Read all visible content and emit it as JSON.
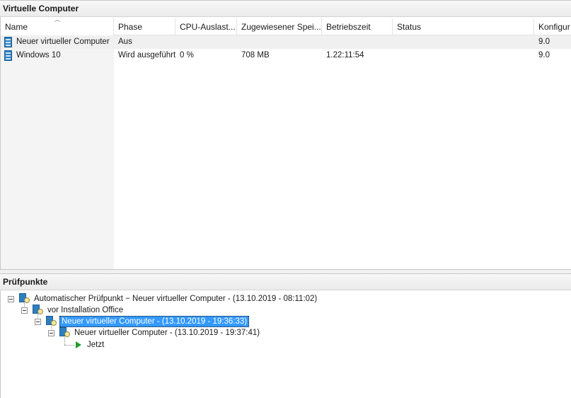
{
  "vm_panel": {
    "title": "Virtuelle Computer",
    "columns": [
      "Name",
      "Phase",
      "CPU-Auslast...",
      "Zugewiesener Spei...",
      "Betriebszeit",
      "Status",
      "Konfigur"
    ],
    "rows": [
      {
        "name": "Neuer virtueller Computer",
        "phase": "Aus",
        "cpu": "",
        "memory": "",
        "uptime": "",
        "status": "",
        "config": "9.0"
      },
      {
        "name": "Windows 10",
        "phase": "Wird ausgeführt",
        "cpu": "0 %",
        "memory": "708 MB",
        "uptime": "1.22:11:54",
        "status": "",
        "config": "9.0"
      }
    ]
  },
  "checkpoint_panel": {
    "title": "Prüfpunkte",
    "nodes": [
      {
        "label": "Automatischer Prüfpunkt − Neuer virtueller Computer - (13.10.2019 - 08:11:02)",
        "level": 0
      },
      {
        "label": "vor Installation Office",
        "level": 1
      },
      {
        "label": "Neuer virtueller Computer - (13.10.2019 - 19:36:33)",
        "level": 2,
        "selected": true
      },
      {
        "label": "Neuer virtueller Computer - (13.10.2019 - 19:37:41)",
        "level": 3
      },
      {
        "label": "Jetzt",
        "level": 4
      }
    ]
  },
  "colors": {
    "selection": "#3399ff",
    "vm_icon": "#2d7fc1",
    "now_icon": "#1f9e2c"
  },
  "icons": {
    "vm": "virtual-machine-icon",
    "checkpoint": "checkpoint-icon",
    "now": "play-icon"
  }
}
